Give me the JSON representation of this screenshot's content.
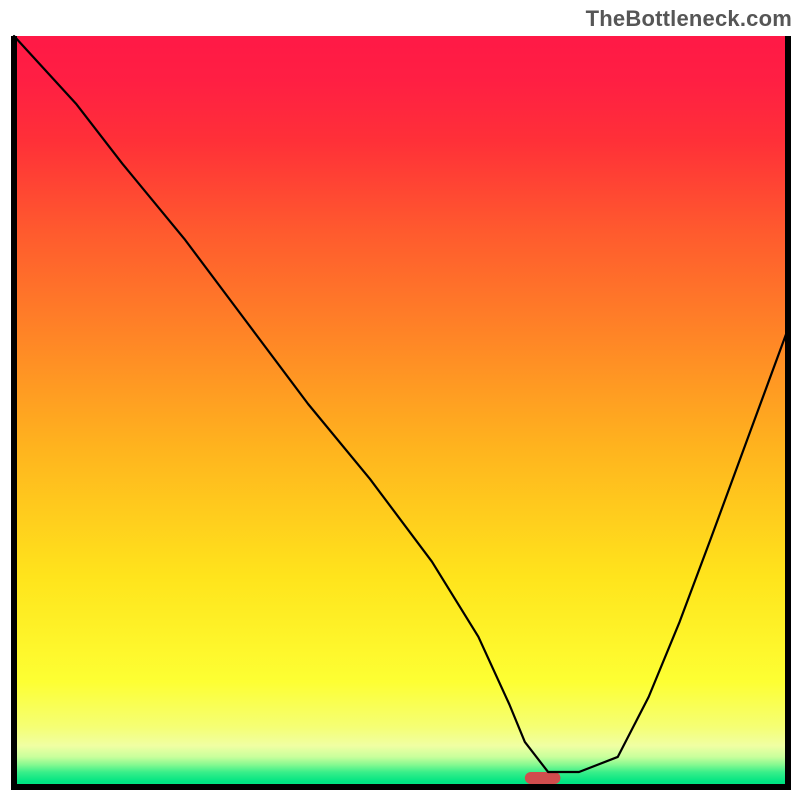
{
  "watermark": "TheBottleneck.com",
  "chart_data": {
    "type": "line",
    "title": "",
    "xlabel": "",
    "ylabel": "",
    "xlim": [
      0,
      100
    ],
    "ylim": [
      0,
      100
    ],
    "x": [
      0,
      8,
      14,
      22,
      30,
      38,
      46,
      54,
      60,
      64,
      66,
      69,
      73,
      78,
      82,
      86,
      90,
      95,
      100
    ],
    "values": [
      100,
      91,
      83,
      73,
      62,
      51,
      41,
      30,
      20,
      11,
      6,
      2,
      2,
      4,
      12,
      22,
      33,
      47,
      61
    ],
    "gradient_stops": [
      {
        "pos": 0.0,
        "color": "#ff1946"
      },
      {
        "pos": 0.06,
        "color": "#ff1f43"
      },
      {
        "pos": 0.14,
        "color": "#ff3038"
      },
      {
        "pos": 0.26,
        "color": "#ff5a2e"
      },
      {
        "pos": 0.4,
        "color": "#ff8526"
      },
      {
        "pos": 0.55,
        "color": "#ffb41e"
      },
      {
        "pos": 0.72,
        "color": "#ffe41c"
      },
      {
        "pos": 0.86,
        "color": "#fdff33"
      },
      {
        "pos": 0.92,
        "color": "#f5ff74"
      },
      {
        "pos": 0.945,
        "color": "#f0ffa3"
      },
      {
        "pos": 0.96,
        "color": "#c8ff9c"
      },
      {
        "pos": 0.97,
        "color": "#88f991"
      },
      {
        "pos": 0.98,
        "color": "#3aef8a"
      },
      {
        "pos": 0.993,
        "color": "#00e582"
      },
      {
        "pos": 1.0,
        "color": "#00e582"
      }
    ],
    "marker": {
      "x_center": 68.3,
      "y_center": 1.2,
      "width": 4.6,
      "height": 1.6,
      "color": "#d04d4d"
    },
    "border_color": "#000000",
    "border_width": 6,
    "line_color": "#000000",
    "line_width": 2.2
  }
}
